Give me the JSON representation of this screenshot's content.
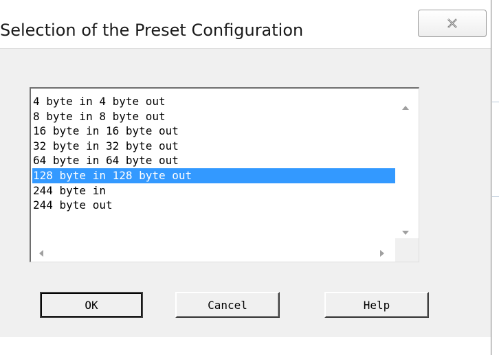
{
  "dialog": {
    "title": "Selection of the Preset Configuration",
    "close_icon": "close-x-icon"
  },
  "list": {
    "items": [
      "4 byte in 4 byte out",
      "8 byte in 8 byte out",
      "16 byte in 16 byte out",
      "32 byte in 32 byte out",
      "64 byte in 64 byte out",
      "128 byte in 128 byte out",
      "244 byte in",
      "244 byte out"
    ],
    "selected_index": 5,
    "selection_color": "#3399ff"
  },
  "buttons": {
    "ok_label": "OK",
    "cancel_label": "Cancel",
    "help_label": "Help"
  }
}
